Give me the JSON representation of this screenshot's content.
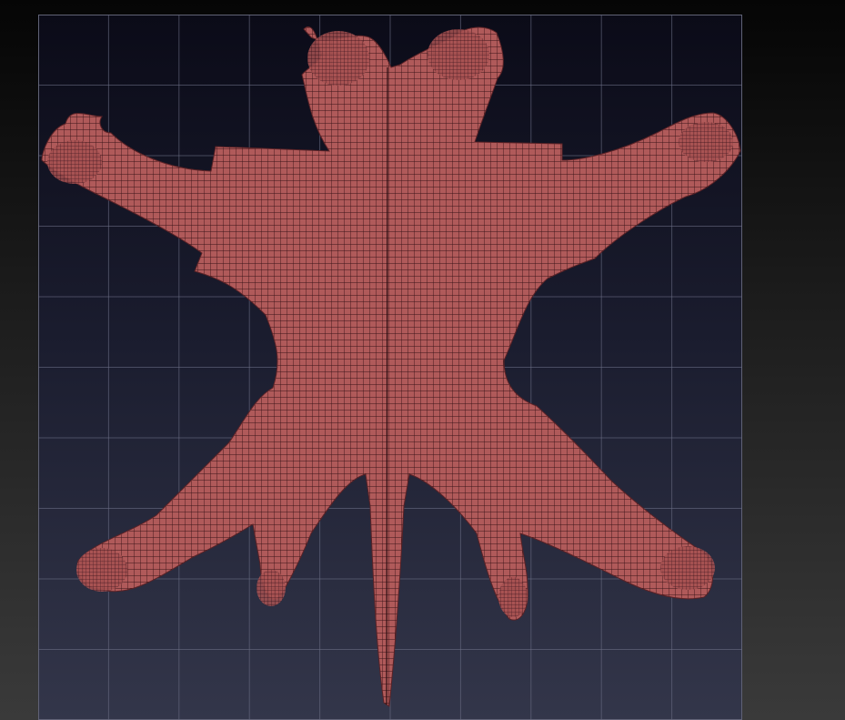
{
  "viewport": {
    "background_top": "#0b0b18",
    "background_bottom": "#33364a",
    "grid_color": "#6a6d84",
    "grid_divisions": 10
  },
  "uv_shell": {
    "fill_color": "#b05a5a",
    "wire_color": "#3a1418",
    "cell_size": 7
  }
}
